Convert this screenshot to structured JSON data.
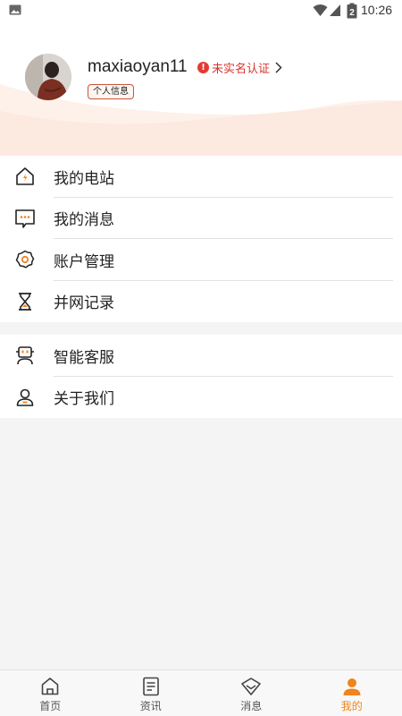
{
  "status_bar": {
    "time": "10:26",
    "battery_level": "2"
  },
  "profile": {
    "username": "maxiaoyan11",
    "verify_text": "未实名认证",
    "info_badge": "个人信息"
  },
  "menu_group_1": [
    {
      "label": "我的电站",
      "icon": "home-bolt-icon"
    },
    {
      "label": "我的消息",
      "icon": "message-icon"
    },
    {
      "label": "账户管理",
      "icon": "settings-gear-icon"
    },
    {
      "label": "并网记录",
      "icon": "hourglass-icon"
    }
  ],
  "menu_group_2": [
    {
      "label": "智能客服",
      "icon": "robot-service-icon"
    },
    {
      "label": "关于我们",
      "icon": "person-icon"
    }
  ],
  "tab_bar": {
    "tabs": [
      {
        "label": "首页",
        "icon": "home-icon"
      },
      {
        "label": "资讯",
        "icon": "news-icon"
      },
      {
        "label": "消息",
        "icon": "message-diamond-icon"
      },
      {
        "label": "我的",
        "icon": "user-icon"
      }
    ],
    "active_index": 3
  },
  "colors": {
    "accent": "#f0841d",
    "warning": "#e33a33",
    "divider": "#e2e2e2",
    "background": "#f4f4f4"
  }
}
